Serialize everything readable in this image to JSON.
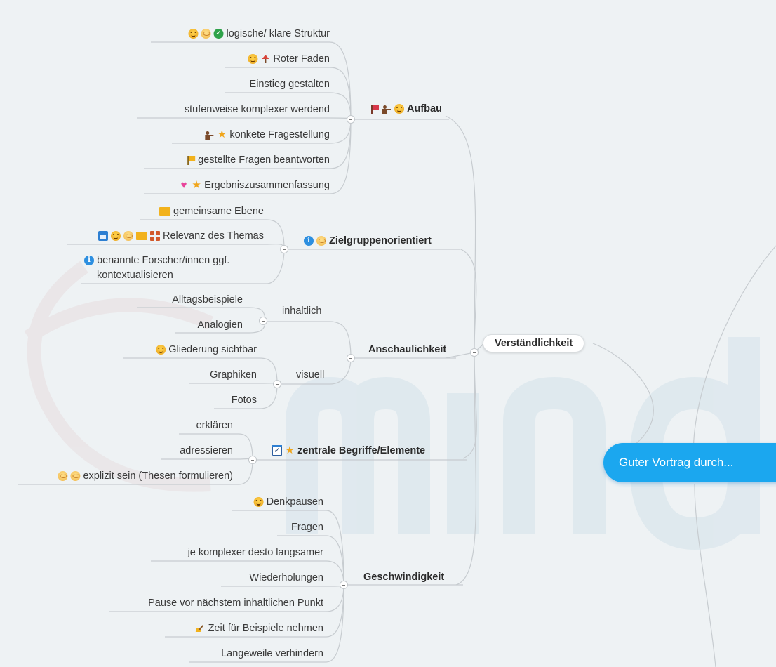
{
  "map": {
    "root": "Guter Vortrag durch...",
    "topic": "Verständlichkeit",
    "branches": {
      "aufbau": {
        "label": "Aufbau",
        "icons": [
          "red-flag-icon",
          "person-pointing-icon",
          "smiley-icon"
        ],
        "children": [
          {
            "label": "logische/ klare Struktur",
            "icons": [
              "smiley-icon",
              "blush-icon",
              "checkmark-icon"
            ]
          },
          {
            "label": "Roter Faden",
            "icons": [
              "smiley-icon",
              "up-arrow-icon"
            ]
          },
          {
            "label": "Einstieg gestalten",
            "icons": []
          },
          {
            "label": "stufenweise komplexer werdend",
            "icons": []
          },
          {
            "label": "konkete Fragestellung",
            "icons": [
              "person-pointing-icon",
              "star-icon"
            ]
          },
          {
            "label": "gestellte Fragen beantworten",
            "icons": [
              "yellow-flag-icon"
            ]
          },
          {
            "label": "Ergebniszusammenfassung",
            "icons": [
              "heart-icon",
              "star-icon"
            ]
          }
        ]
      },
      "zielgruppe": {
        "label": "Zielgruppenorientiert",
        "icons": [
          "info-icon",
          "blush-icon"
        ],
        "children": [
          {
            "label": "gemeinsame Ebene",
            "icons": [
              "yellow-rect-icon"
            ]
          },
          {
            "label": "Relevanz des Themas",
            "icons": [
              "calendar-icon",
              "smiley-icon",
              "blush-icon",
              "yellow-rect-icon",
              "grid-icon"
            ]
          },
          {
            "label_line1": "benannte Forscher/innen ggf.",
            "label_line2": "kontextualisieren",
            "icons": [
              "info-icon"
            ]
          }
        ]
      },
      "anschaulichkeit": {
        "label": "Anschaulichkeit",
        "inhaltlich": {
          "label": "inhaltlich",
          "children": [
            {
              "label": "Alltagsbeispiele"
            },
            {
              "label": "Analogien"
            }
          ]
        },
        "visuell": {
          "label": "visuell",
          "children": [
            {
              "label": "Gliederung sichtbar",
              "icons": [
                "smiley-icon"
              ]
            },
            {
              "label": "Graphiken"
            },
            {
              "label": "Fotos"
            }
          ]
        }
      },
      "begriffe": {
        "label": "zentrale Begriffe/Elemente",
        "icons": [
          "checkbox-icon",
          "star-icon"
        ],
        "children": [
          {
            "label": "erklären"
          },
          {
            "label": "adressieren"
          },
          {
            "label": "explizit sein (Thesen formulieren)",
            "icons": [
              "blush-icon",
              "blush-icon"
            ]
          }
        ]
      },
      "geschwindigkeit": {
        "label": "Geschwindigkeit",
        "children": [
          {
            "label": "Denkpausen",
            "icons": [
              "smiley-icon"
            ]
          },
          {
            "label": "Fragen"
          },
          {
            "label": "je komplexer desto langsamer"
          },
          {
            "label": "Wiederholungen"
          },
          {
            "label": "Pause vor nächstem inhaltlichen Punkt"
          },
          {
            "label": "Zeit für Beispiele nehmen",
            "icons": [
              "brush-icon"
            ]
          },
          {
            "label": "Langeweile verhindern"
          }
        ]
      }
    }
  }
}
